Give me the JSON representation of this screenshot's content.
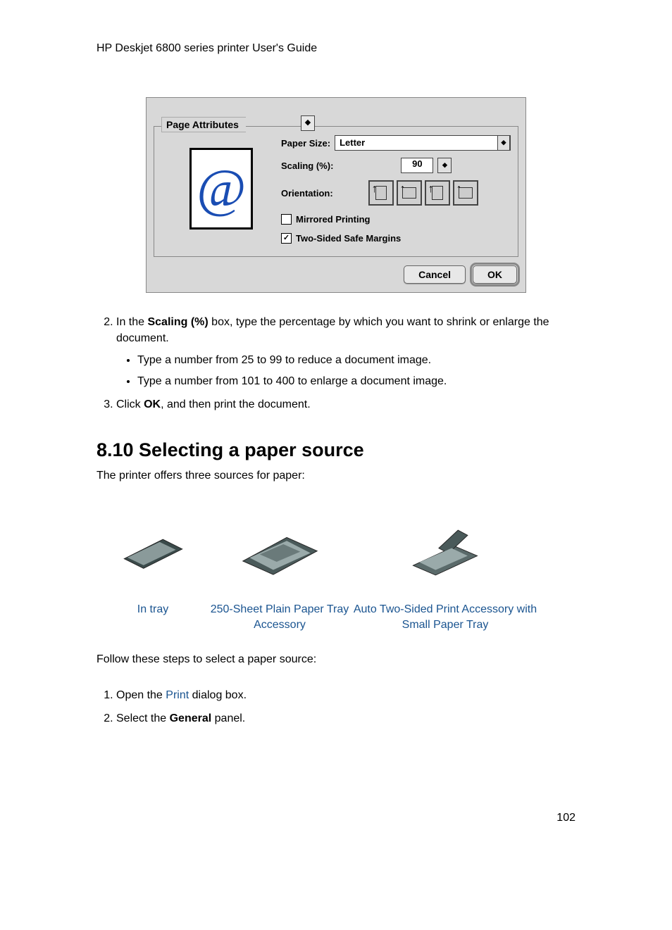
{
  "header": {
    "breadcrumb": "HP Deskjet 6800 series printer User's Guide"
  },
  "dialog": {
    "legend": "Page Attributes",
    "paper_size_label": "Paper Size:",
    "paper_size_value": "Letter",
    "scaling_label": "Scaling (%):",
    "scaling_value": "90",
    "orientation_label": "Orientation:",
    "mirrored_label": "Mirrored Printing",
    "twosided_label": "Two-Sided Safe Margins",
    "cancel": "Cancel",
    "ok": "OK",
    "check_mark": "✓",
    "spinner_glyph": "◆",
    "arrow_glyph": "↑"
  },
  "list": {
    "item2_prefix": "In the ",
    "item2_bold": "Scaling (%)",
    "item2_suffix": " box, type the percentage by which you want to shrink or enlarge the document.",
    "bullet1": "Type a number from 25 to 99 to reduce a document image.",
    "bullet2": "Type a number from 101 to 400 to enlarge a document image.",
    "item3_prefix": "Click ",
    "item3_bold": "OK",
    "item3_suffix": ", and then print the document."
  },
  "section": {
    "title": "8.10  Selecting a paper source",
    "intro": "The printer offers three sources for paper:",
    "sources": {
      "c1": "In tray",
      "c2": "250-Sheet Plain Paper Tray Accessory",
      "c3": "Auto Two-Sided Print Accessory with Small Paper Tray"
    },
    "follow": "Follow these steps to select a paper source:",
    "step1_prefix": "Open the ",
    "step1_link": "Print",
    "step1_suffix": " dialog box.",
    "step2_prefix": "Select the ",
    "step2_bold": "General",
    "step2_suffix": " panel."
  },
  "page_number": "102"
}
